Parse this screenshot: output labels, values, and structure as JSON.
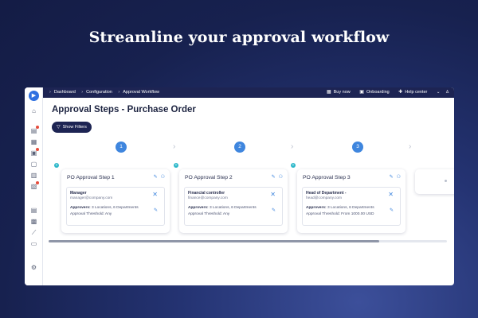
{
  "headline": "Streamline your approval workflow",
  "breadcrumb": [
    "Dashboard",
    "Configuration",
    "Approval Workflow"
  ],
  "top_actions": [
    {
      "label": "Buy now",
      "icon": "cart-icon"
    },
    {
      "label": "Onboarding",
      "icon": "onboarding-icon"
    },
    {
      "label": "Help center",
      "icon": "help-icon"
    }
  ],
  "page_title": "Approval Steps - Purchase Order",
  "filter_button": "Show Filters",
  "steps": [
    "1",
    "2",
    "3"
  ],
  "cards": [
    {
      "title": "PO Approval Step 1",
      "role": "Manager",
      "email": "manager@company.com",
      "approvers_label": "Approvers:",
      "approvers_value": "3 Locations, 6 Departments",
      "threshold": "Approval Threshold: Any"
    },
    {
      "title": "PO Approval Step 2",
      "role": "Financial controller",
      "email": "finance@company.com",
      "approvers_label": "Approvers:",
      "approvers_value": "3 Locations, 6 Departments",
      "threshold": "Approval Threshold: Any"
    },
    {
      "title": "PO Approval Step 3",
      "role": "Head of Department -",
      "email": "head@company.com",
      "approvers_label": "Approvers:",
      "approvers_value": "3 Locations, 6 Departments",
      "threshold": "Approval Threshold: From 1000.00 USD"
    }
  ],
  "scroll_position": 0.83,
  "colors": {
    "accent": "#3f86de",
    "topbar": "#1d2453",
    "badge": "#2bb7c9"
  }
}
